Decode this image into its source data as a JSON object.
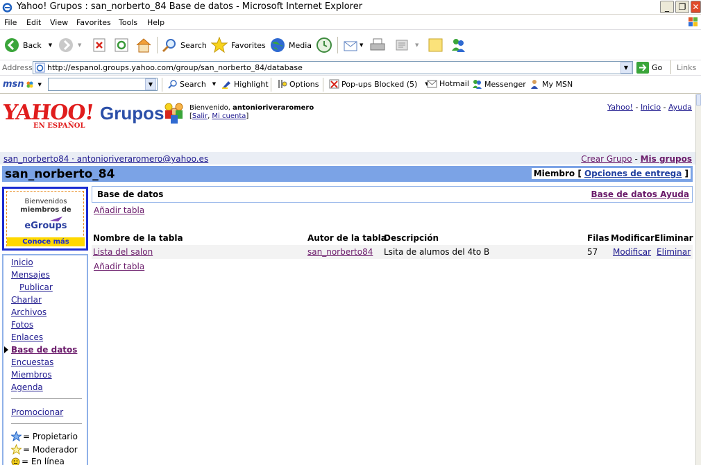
{
  "window": {
    "title": "Yahoo! Grupos : san_norberto_84 Base de datos - Microsoft Internet Explorer"
  },
  "menu": [
    "File",
    "Edit",
    "View",
    "Favorites",
    "Tools",
    "Help"
  ],
  "toolbar": {
    "back": "Back",
    "search": "Search",
    "favorites": "Favorites",
    "media": "Media"
  },
  "address": {
    "label": "Address",
    "url": "http://espanol.groups.yahoo.com/group/san_norberto_84/database",
    "go": "Go",
    "links": "Links"
  },
  "msn": {
    "logo": "msn",
    "search": "Search",
    "highlight": "Highlight",
    "options": "Options",
    "popups": "Pop-ups Blocked (5)",
    "hotmail": "Hotmail",
    "messenger": "Messenger",
    "mymsn": "My MSN"
  },
  "header": {
    "logo_main": "YAHOO!",
    "logo_sub": "EN ESPAÑOL",
    "grupos": "Grupos",
    "welcome_prefix": "Bienvenido,",
    "username": "antonioriveraromero",
    "salir": "Salir",
    "mi_cuenta": "Mi cuenta",
    "top_links": [
      "Yahoo!",
      "Inicio",
      "Ayuda"
    ]
  },
  "userline": {
    "group_email": "san_norberto84 · antonioriveraromero@yahoo.es",
    "crear_grupo": "Crear Grupo",
    "mis_grupos": "Mis grupos"
  },
  "group": {
    "name": "san_norberto_84",
    "miembro": "Miembro",
    "opciones": "Opciones de entrega"
  },
  "promo": {
    "line1": "Bienvenidos",
    "line2": "miembros de",
    "brand": "eGroups",
    "button": "Conoce más"
  },
  "sidebar": {
    "items": [
      "Inicio",
      "Mensajes",
      "Publicar",
      "Charlar",
      "Archivos",
      "Fotos",
      "Enlaces",
      "Base de datos",
      "Encuestas",
      "Miembros",
      "Agenda"
    ],
    "promocionar": "Promocionar",
    "legend": [
      "= Propietario",
      "= Moderador",
      "= En línea"
    ]
  },
  "main": {
    "title": "Base de datos",
    "help": "Base de datos Ayuda",
    "add_table": "Añadir tabla",
    "columns": [
      "Nombre de la tabla",
      "Autor de la tabla",
      "Descripción",
      "Filas",
      "Modificar",
      "Eliminar"
    ],
    "rows": [
      {
        "name": "Lista del salon",
        "author": "san_norberto84",
        "description": "Lsita de alumos del 4to B",
        "filas": "57",
        "modificar": "Modificar",
        "eliminar": "Eliminar"
      }
    ]
  }
}
